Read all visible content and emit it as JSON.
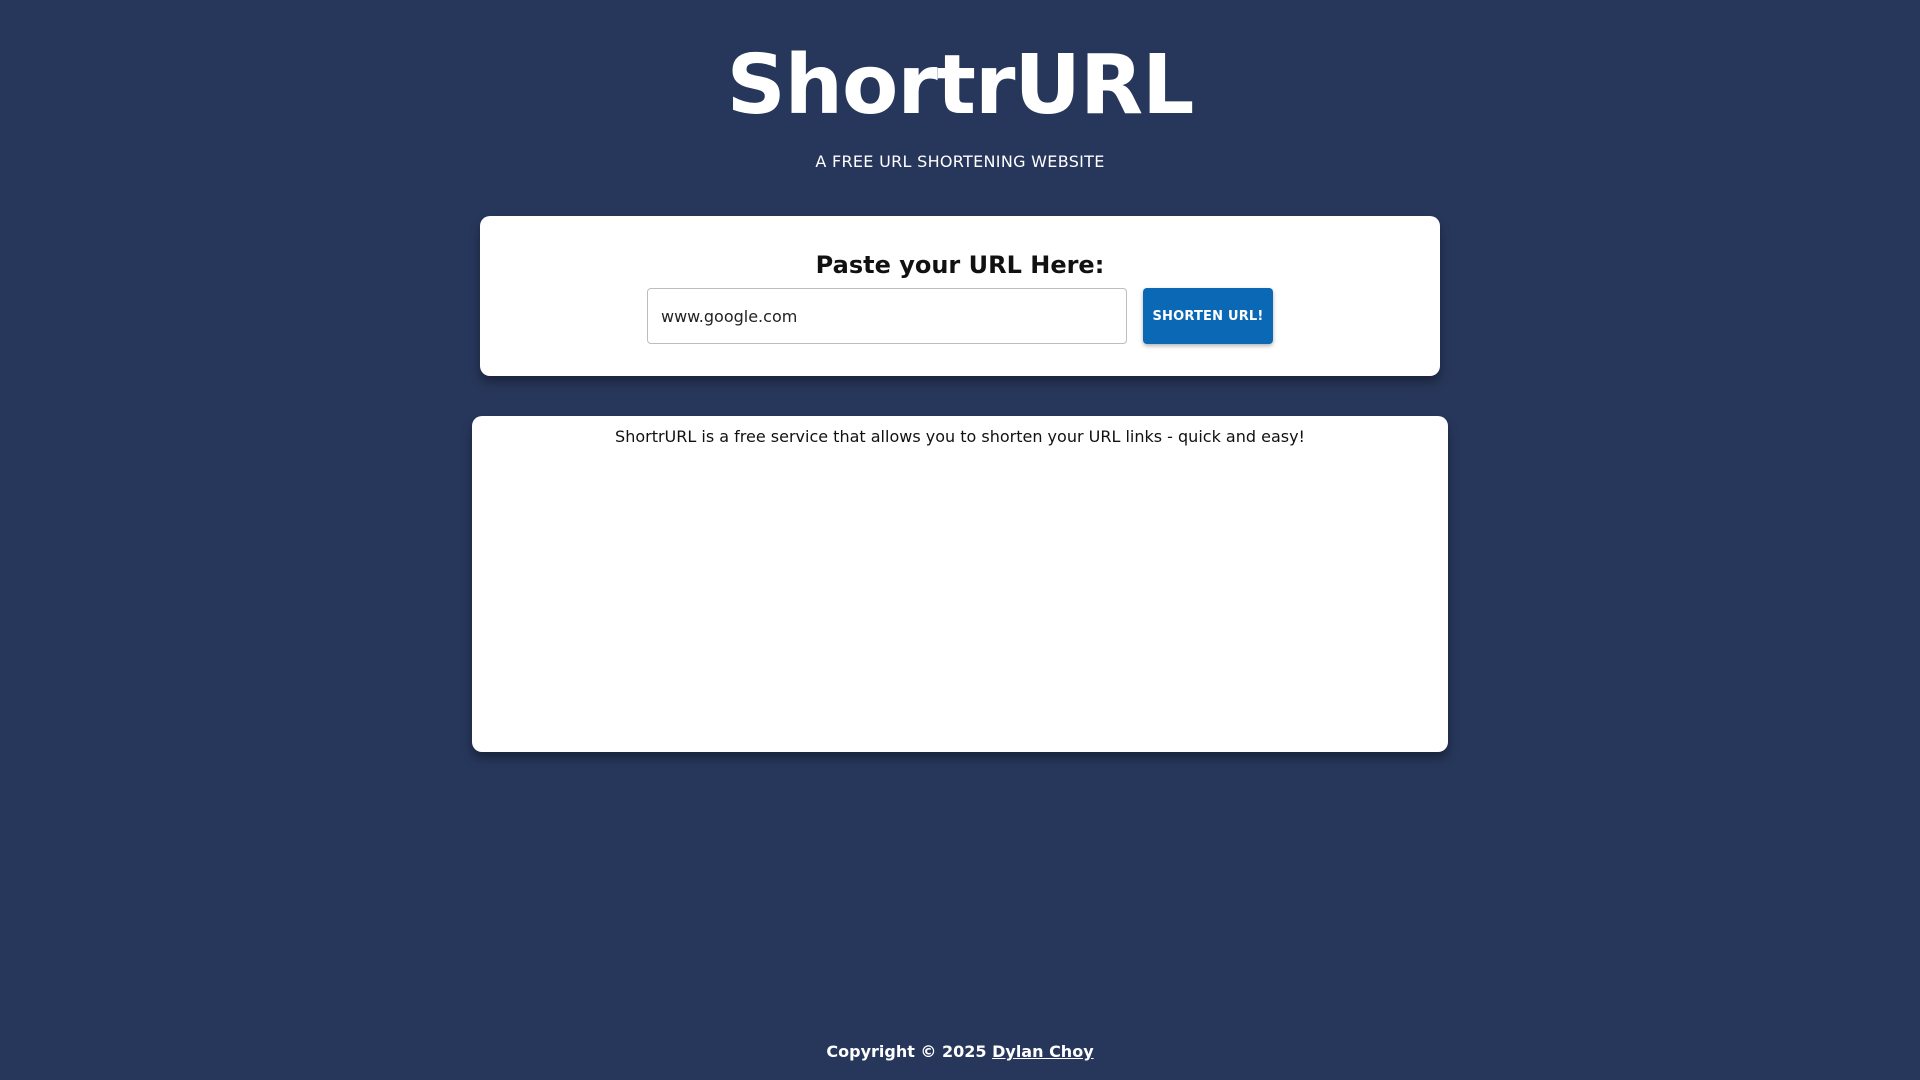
{
  "header": {
    "title": "ShortrURL",
    "subtitle": "A FREE URL SHORTENING WEBSITE"
  },
  "url_form": {
    "heading": "Paste your URL Here:",
    "input_value": "www.google.com",
    "button_label": "SHORTEN URL!"
  },
  "info": {
    "text": "ShortrURL is a free service that allows you to shorten your URL links - quick and easy!"
  },
  "footer": {
    "copyright": "Copyright © 2025",
    "author_link": "Dylan Choy"
  },
  "colors": {
    "background": "#27375b",
    "card": "#ffffff",
    "button": "#0b68b5"
  }
}
